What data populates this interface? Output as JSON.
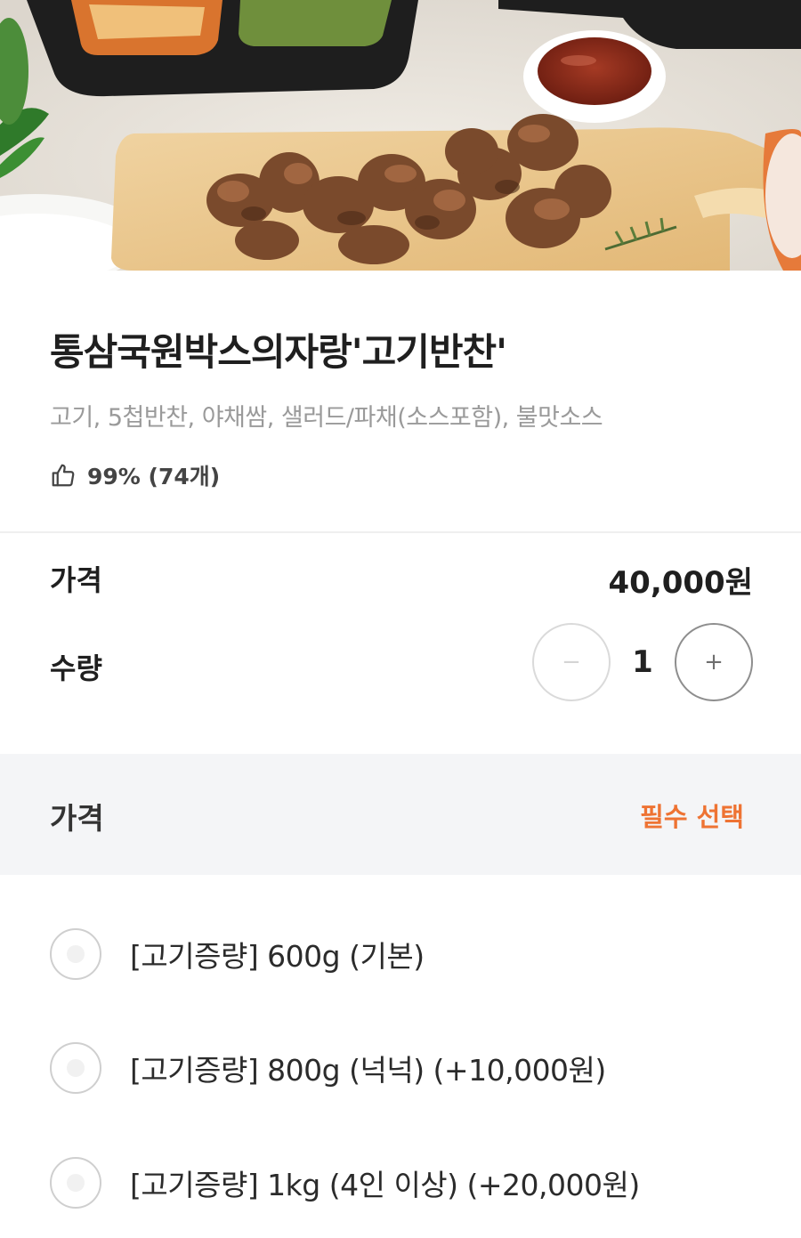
{
  "product": {
    "title": "통삼국원박스의자랑'고기반찬'",
    "subtitle": "고기, 5첩반찬, 야채쌈, 샐러드/파채(소스포함), 불맛소스",
    "rating": {
      "icon": "thumbs-up-icon",
      "text": "99% (74개)"
    }
  },
  "price": {
    "label": "가격",
    "value": "40,000원"
  },
  "quantity": {
    "label": "수량",
    "value": "1",
    "minus_label": "−",
    "plus_label": "+"
  },
  "option_group": {
    "label": "가격",
    "required_text": "필수 선택",
    "required_color": "#ee7333",
    "options": [
      {
        "label": "[고기증량] 600g (기본)",
        "selected": false
      },
      {
        "label": "[고기증량] 800g (넉넉) (+10,000원)",
        "selected": false
      },
      {
        "label": "[고기증량] 1kg (4인 이상) (+20,000원)",
        "selected": false
      }
    ]
  }
}
